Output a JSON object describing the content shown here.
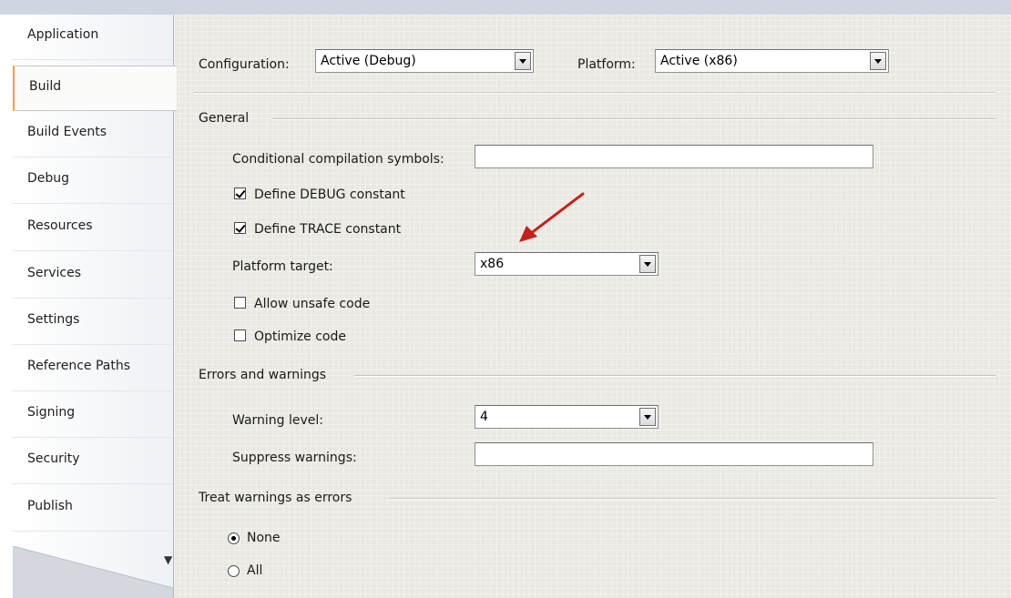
{
  "sidebar": {
    "tabs": [
      {
        "label": "Application"
      },
      {
        "label": "Build"
      },
      {
        "label": "Build Events"
      },
      {
        "label": "Debug"
      },
      {
        "label": "Resources"
      },
      {
        "label": "Services"
      },
      {
        "label": "Settings"
      },
      {
        "label": "Reference Paths"
      },
      {
        "label": "Signing"
      },
      {
        "label": "Security"
      },
      {
        "label": "Publish"
      }
    ],
    "active_tab": "Build",
    "scroll_glyph": "▼"
  },
  "header": {
    "configuration_label": "Configuration:",
    "configuration_value": "Active (Debug)",
    "platform_label": "Platform:",
    "platform_value": "Active (x86)"
  },
  "general": {
    "title": "General",
    "conditional_symbols_label": "Conditional compilation symbols:",
    "conditional_symbols_value": "",
    "define_debug_label": "Define DEBUG constant",
    "define_debug_checked": true,
    "define_trace_label": "Define TRACE constant",
    "define_trace_checked": true,
    "platform_target_label": "Platform target:",
    "platform_target_value": "x86",
    "allow_unsafe_label": "Allow unsafe code",
    "allow_unsafe_checked": false,
    "optimize_label": "Optimize code",
    "optimize_checked": false
  },
  "errors": {
    "title": "Errors and warnings",
    "warning_level_label": "Warning level:",
    "warning_level_value": "4",
    "suppress_label": "Suppress warnings:",
    "suppress_value": ""
  },
  "treat_warnings": {
    "title": "Treat warnings as errors",
    "options": [
      {
        "label": "None",
        "selected": true
      },
      {
        "label": "All",
        "selected": false
      }
    ]
  },
  "colors": {
    "annotation_arrow": "#c8201c",
    "active_tab_accent": "#e6a43c"
  }
}
